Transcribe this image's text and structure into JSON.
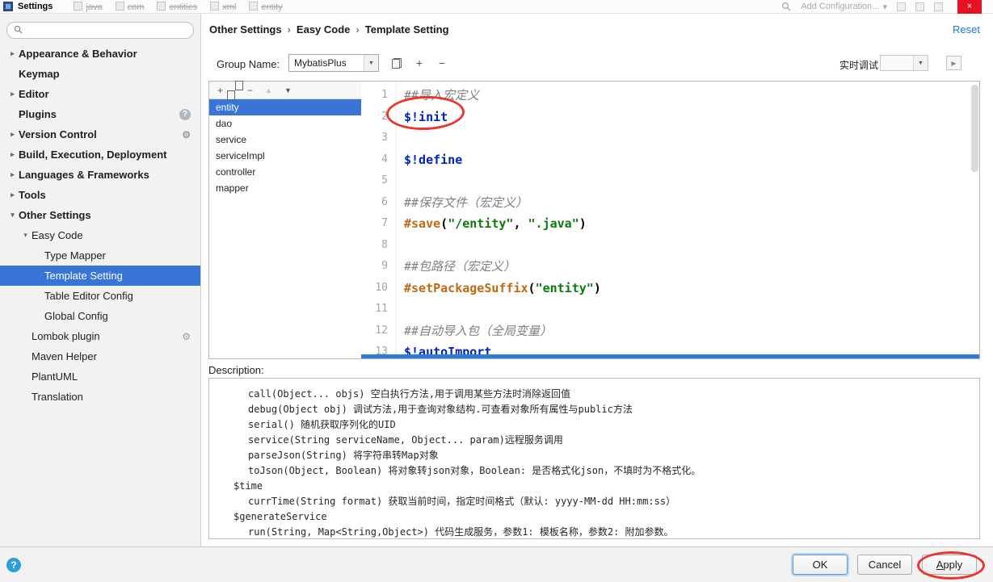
{
  "titlebar": {
    "title": "Settings",
    "bg_tabs": [
      "java",
      "com",
      "entities",
      "xml",
      "entity"
    ],
    "add_configuration": "Add Configuration..."
  },
  "icons": {
    "caret_down": "▾",
    "combo_arrow": "▼",
    "add": "+",
    "remove": "−",
    "move_up": "▲",
    "move_down": "▼",
    "run": "▶",
    "close": "×",
    "help": "?",
    "chevron_collapsed": "▸",
    "chevron_expanded": "▾"
  },
  "sidebar": {
    "search_placeholder": "",
    "items": [
      {
        "label": "Appearance & Behavior",
        "level": 0,
        "bold": true,
        "arrow": "collapsed"
      },
      {
        "label": "Keymap",
        "level": 0,
        "bold": true
      },
      {
        "label": "Editor",
        "level": 0,
        "bold": true,
        "arrow": "collapsed"
      },
      {
        "label": "Plugins",
        "level": 0,
        "bold": true,
        "badge": "question-circle"
      },
      {
        "label": "Version Control",
        "level": 0,
        "bold": true,
        "arrow": "collapsed",
        "badge": "gear"
      },
      {
        "label": "Build, Execution, Deployment",
        "level": 0,
        "bold": true,
        "arrow": "collapsed"
      },
      {
        "label": "Languages & Frameworks",
        "level": 0,
        "bold": true,
        "arrow": "collapsed"
      },
      {
        "label": "Tools",
        "level": 0,
        "bold": true,
        "arrow": "collapsed"
      },
      {
        "label": "Other Settings",
        "level": 0,
        "bold": true,
        "arrow": "expanded"
      },
      {
        "label": "Easy Code",
        "level": 1,
        "arrow": "expanded"
      },
      {
        "label": "Type Mapper",
        "level": 2
      },
      {
        "label": "Template Setting",
        "level": 2,
        "selected": true
      },
      {
        "label": "Table Editor Config",
        "level": 2
      },
      {
        "label": "Global Config",
        "level": 2
      },
      {
        "label": "Lombok plugin",
        "level": 1,
        "badge": "gear"
      },
      {
        "label": "Maven Helper",
        "level": 1
      },
      {
        "label": "PlantUML",
        "level": 1
      },
      {
        "label": "Translation",
        "level": 1
      }
    ]
  },
  "header": {
    "breadcrumb": [
      "Other Settings",
      "Easy Code",
      "Template Setting"
    ],
    "reset": "Reset"
  },
  "toolbar": {
    "group_name_label": "Group Name:",
    "group_name_value": "MybatisPlus",
    "debug_label": "实时调试",
    "debug_combo_value": ""
  },
  "template_list": {
    "items": [
      "entity",
      "dao",
      "service",
      "serviceImpl",
      "controller",
      "mapper"
    ],
    "selected": "entity"
  },
  "editor": {
    "lines": [
      {
        "n": 1,
        "tokens": [
          {
            "t": "##导入宏定义",
            "c": "comment"
          }
        ]
      },
      {
        "n": 2,
        "tokens": [
          {
            "t": "$!init",
            "c": "macro"
          }
        ]
      },
      {
        "n": 3,
        "tokens": []
      },
      {
        "n": 4,
        "tokens": [
          {
            "t": "$!define",
            "c": "macro"
          }
        ]
      },
      {
        "n": 5,
        "tokens": []
      },
      {
        "n": 6,
        "tokens": [
          {
            "t": "##保存文件（宏定义）",
            "c": "comment"
          }
        ]
      },
      {
        "n": 7,
        "tokens": [
          {
            "t": "#save",
            "c": "directive"
          },
          {
            "t": "(",
            "c": "plain"
          },
          {
            "t": "\"/entity\"",
            "c": "string"
          },
          {
            "t": ", ",
            "c": "plain"
          },
          {
            "t": "\".java\"",
            "c": "string"
          },
          {
            "t": ")",
            "c": "plain"
          }
        ]
      },
      {
        "n": 8,
        "tokens": []
      },
      {
        "n": 9,
        "tokens": [
          {
            "t": "##包路径（宏定义）",
            "c": "comment"
          }
        ]
      },
      {
        "n": 10,
        "tokens": [
          {
            "t": "#setPackageSuffix",
            "c": "directive"
          },
          {
            "t": "(",
            "c": "plain"
          },
          {
            "t": "\"entity\"",
            "c": "string"
          },
          {
            "t": ")",
            "c": "plain"
          }
        ]
      },
      {
        "n": 11,
        "tokens": []
      },
      {
        "n": 12,
        "tokens": [
          {
            "t": "##自动导入包（全局变量）",
            "c": "comment"
          }
        ]
      },
      {
        "n": 13,
        "tokens": [
          {
            "t": "$!autoImport",
            "c": "macro"
          }
        ]
      }
    ]
  },
  "description": {
    "label": "Description:",
    "lines": [
      {
        "indent": 2,
        "text": "call(Object... objs) 空白执行方法,用于调用某些方法时消除返回值"
      },
      {
        "indent": 2,
        "text": "debug(Object obj) 调试方法,用于查询对象结构.可查看对象所有属性与public方法"
      },
      {
        "indent": 2,
        "text": "serial() 随机获取序列化的UID"
      },
      {
        "indent": 2,
        "text": "service(String serviceName, Object... param)远程服务调用"
      },
      {
        "indent": 2,
        "text": "parseJson(String) 将字符串转Map对象"
      },
      {
        "indent": 2,
        "text": "toJson(Object, Boolean) 将对象转json对象，Boolean: 是否格式化json，不填时为不格式化。"
      },
      {
        "indent": 1,
        "text": "$time"
      },
      {
        "indent": 2,
        "text": "currTime(String format) 获取当前时间，指定时间格式（默认: yyyy-MM-dd HH:mm:ss）"
      },
      {
        "indent": 1,
        "text": "$generateService"
      },
      {
        "indent": 2,
        "text": "run(String, Map<String,Object>) 代码生成服务，参数1: 模板名称，参数2: 附加参数。"
      }
    ]
  },
  "footer": {
    "help": "?",
    "buttons": [
      {
        "label": "OK",
        "default": true
      },
      {
        "label": "Cancel"
      },
      {
        "label": "Apply",
        "mnemonic": 0
      }
    ]
  },
  "annotations": {
    "color": "#E8372F",
    "targets": [
      "$!init macro in editor",
      "Apply button"
    ]
  },
  "colors": {
    "selection_blue": "#3875D6",
    "link_blue": "#2175D9",
    "close_red": "#E81123",
    "macro_blue": "#0023B8",
    "directive_orange": "#BE6A12",
    "string_green": "#0B7A0B"
  }
}
